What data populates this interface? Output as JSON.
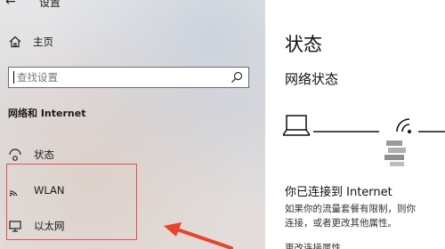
{
  "window": {
    "title": "设置"
  },
  "sidebar": {
    "home_label": "主页",
    "search": {
      "placeholder": "查找设置"
    },
    "section_heading": "网络和 Internet",
    "items": [
      {
        "label": "状态",
        "icon": "status-icon"
      },
      {
        "label": "WLAN",
        "icon": "wifi-icon"
      },
      {
        "label": "以太网",
        "icon": "ethernet-icon"
      }
    ]
  },
  "main": {
    "title": "状态",
    "subtitle": "网络状态",
    "connected_text": "你已连接到 Internet",
    "description_line1": "如果你的流量套餐有限制，则你",
    "description_line2": "连接，或者更改其他属性。",
    "change_link": "更改连接属性"
  },
  "annotation": {
    "highlight_color": "#e05050"
  }
}
